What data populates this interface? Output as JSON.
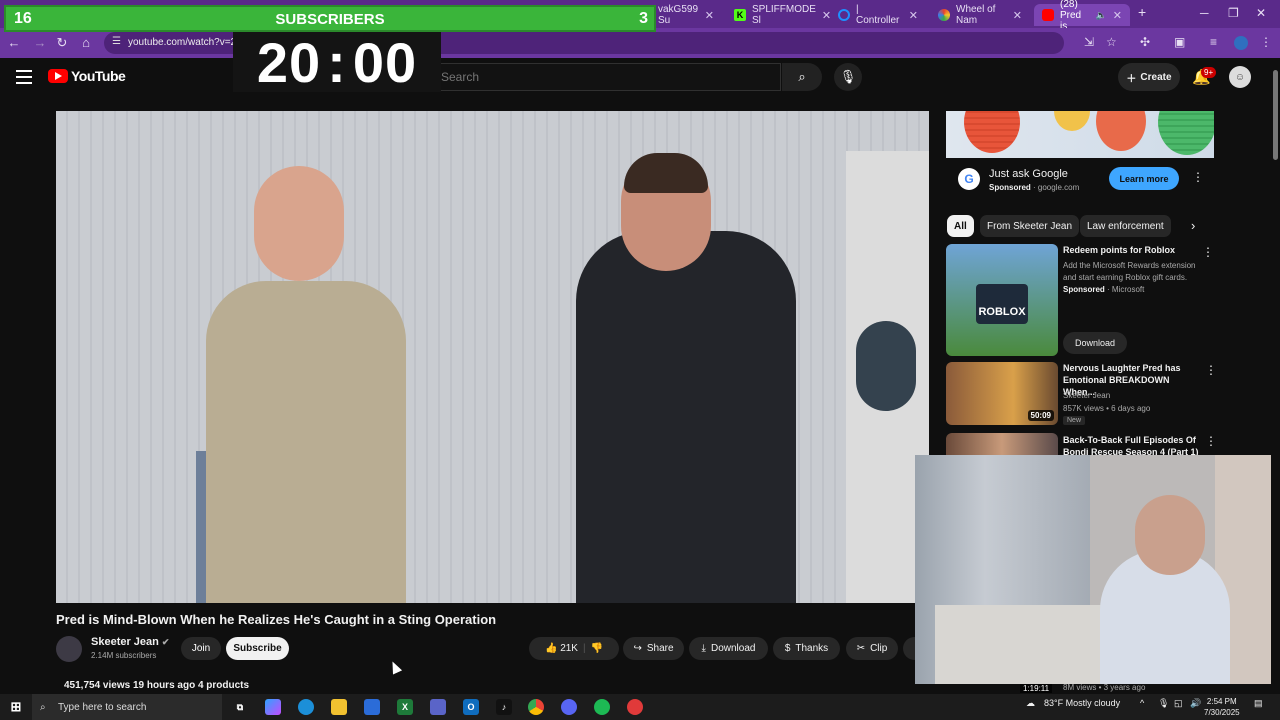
{
  "browser": {
    "tabs": [
      {
        "label": "vakG599 Su",
        "fav": "",
        "color": "#9146ff"
      },
      {
        "label": "SPLIFFMODE Sl",
        "fav": "K",
        "color": "#53fc18"
      },
      {
        "label": "| Controller",
        "fav": "",
        "color": "#1e90ff"
      },
      {
        "label": "Wheel of Nam",
        "fav": "",
        "color": "#e8412c"
      },
      {
        "label": "(28) Pred is",
        "fav": "",
        "color": "#ff0000"
      }
    ],
    "url": "youtube.com/watch?v=25",
    "new_tab_glyph": "+"
  },
  "overlay": {
    "left_count": "16",
    "label": "SUBSCRIBERS",
    "right_count": "3",
    "timer_min": "20",
    "timer_sep": ":",
    "timer_sec": "00"
  },
  "youtube": {
    "logo_text": "YouTube",
    "search_placeholder": "Search",
    "create_label": "Create",
    "notif_badge": "9+",
    "video": {
      "title": "Pred is Mind-Blown When he Realizes He's Caught in a Sting Operation",
      "channel": "Skeeter Jean",
      "verified_glyph": "✔",
      "subscribers": "2.14M subscribers",
      "join_label": "Join",
      "subscribe_label": "Subscribe",
      "likes": "21K",
      "share_label": "Share",
      "download_label": "Download",
      "thanks_label": "Thanks",
      "clip_label": "Clip",
      "views_line": "451,754 views  19 hours ago  4 products"
    },
    "ad": {
      "title": "Just ask Google",
      "sponsored": "Sponsored",
      "domain": "google.com",
      "cta": "Learn more"
    },
    "chips": [
      "All",
      "From Skeeter Jean",
      "Law enforcement"
    ],
    "recommendations": [
      {
        "title1": "Redeem points for Roblox",
        "desc1": "Add the Microsoft Rewards extension",
        "desc2": "and start earning Roblox gift cards.",
        "sponsor": "Sponsored",
        "by": "Microsoft",
        "thumb_text": "ROBLOX",
        "cta": "Download"
      },
      {
        "title1": "Nervous Laughter Pred has",
        "title2": "Emotional BREAKDOWN When...",
        "channel": "Skeeter Jean",
        "meta": "857K views • 6 days ago",
        "badge": "New",
        "duration": "50:09"
      },
      {
        "title1": "Back-To-Back Full Episodes Of",
        "title2": "Bondi Rescue Season 4 (Part 1)"
      }
    ],
    "hidden_row_meta": "8M views • 3 years ago",
    "hidden_row_duration": "1:19:11"
  },
  "taskbar": {
    "search_placeholder": "Type here to search",
    "weather": "83°F  Mostly cloudy",
    "time": "2:54 PM",
    "date": "7/30/2025"
  }
}
